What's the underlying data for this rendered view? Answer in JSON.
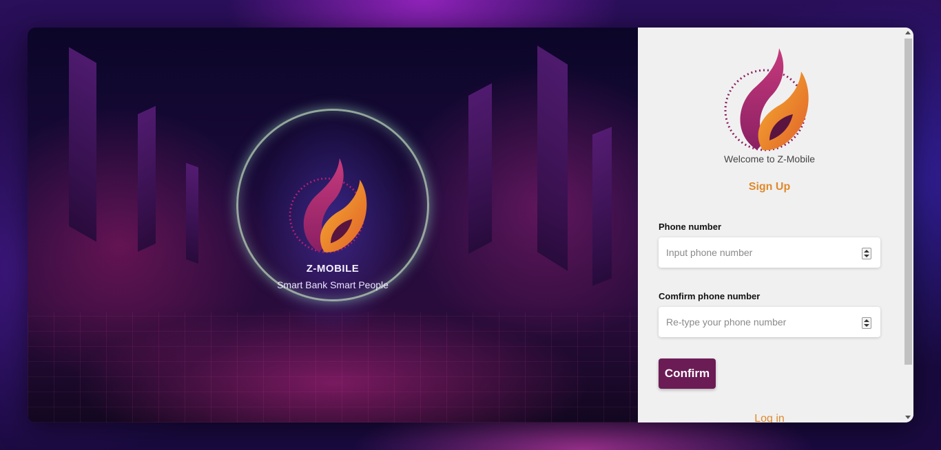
{
  "hero": {
    "brand_name": "Z-MOBILE",
    "tagline": "Smart Bank Smart People"
  },
  "panel": {
    "welcome_text": "Welcome to Z-Mobile",
    "heading": "Sign Up",
    "phone": {
      "label": "Phone number",
      "placeholder": "Input phone number",
      "value": ""
    },
    "confirm_phone": {
      "label": "Comfirm phone number",
      "placeholder": "Re-type your phone number",
      "value": ""
    },
    "confirm_button_label": "Confirm",
    "login_link_label": "Log in"
  },
  "icons": {
    "logo": "flame-logo-icon",
    "spinner": "number-spinner-icon",
    "scroll_up": "scroll-up-arrow-icon",
    "scroll_down": "scroll-down-arrow-icon"
  },
  "colors": {
    "accent_orange": "#e0892a",
    "button_purple": "#6b1c55",
    "panel_background": "#f0f0f0",
    "logo_magenta": "#a0286e",
    "logo_orange": "#f39a1e"
  }
}
